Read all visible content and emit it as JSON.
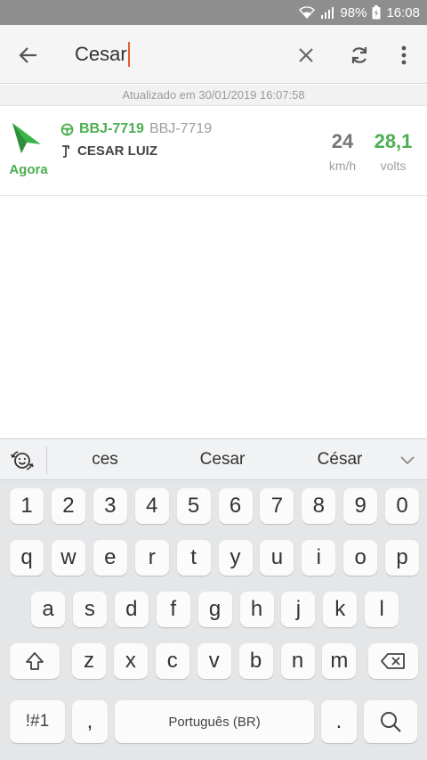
{
  "status_bar": {
    "battery": "98%",
    "time": "16:08"
  },
  "search": {
    "value": "Cesar"
  },
  "updated": {
    "text": "Atualizado em 30/01/2019 16:07:58"
  },
  "vehicle": {
    "time_label": "Agora",
    "plate_primary": "BBJ-7719",
    "plate_secondary": "BBJ-7719",
    "driver": "CESAR LUIZ",
    "speed": "24",
    "speed_unit": "km/h",
    "voltage": "28,1",
    "voltage_unit": "volts"
  },
  "keyboard": {
    "suggestions": [
      "ces",
      "Cesar",
      "César"
    ],
    "row_numbers": [
      "1",
      "2",
      "3",
      "4",
      "5",
      "6",
      "7",
      "8",
      "9",
      "0"
    ],
    "row1": [
      "q",
      "w",
      "e",
      "r",
      "t",
      "y",
      "u",
      "i",
      "o",
      "p"
    ],
    "row2": [
      "a",
      "s",
      "d",
      "f",
      "g",
      "h",
      "j",
      "k",
      "l"
    ],
    "row3": [
      "z",
      "x",
      "c",
      "v",
      "b",
      "n",
      "m"
    ],
    "symbols_label": "!#1",
    "comma_label": ",",
    "space_label": "Português (BR)",
    "period_label": "."
  },
  "colors": {
    "accent_green": "#4caf50",
    "caret": "#e65c2b",
    "status_bar": "#8e8e8e"
  }
}
